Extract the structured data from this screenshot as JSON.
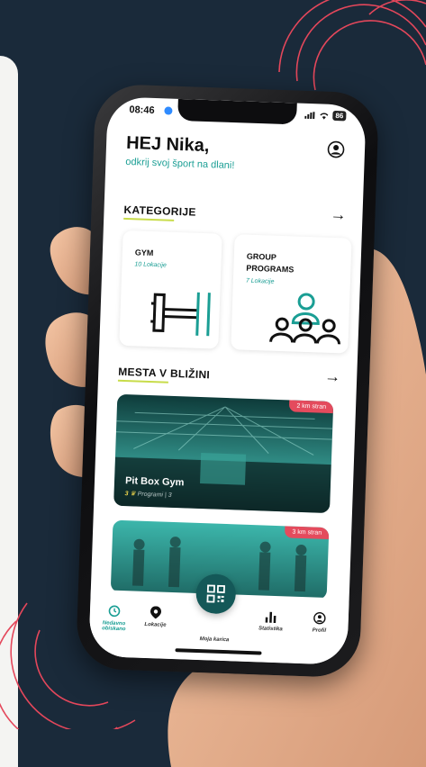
{
  "status_bar": {
    "time": "08:46",
    "battery": "86"
  },
  "header": {
    "greeting": "HEJ Nika,",
    "tagline": "odkrij svoj šport na dlani!"
  },
  "categories_section": {
    "title": "KATEGORIJE",
    "cards": [
      {
        "name": "GYM",
        "count": "10 Lokacije"
      },
      {
        "name": "GROUP\nPROGRAMS",
        "count": "7 Lokacije"
      }
    ]
  },
  "nearby_section": {
    "title": "MESTA V BLIŽINI",
    "places": [
      {
        "name": "Pit Box Gym",
        "distance": "2 km stran",
        "rating": "3",
        "meta": "Programi | 3"
      },
      {
        "name": "",
        "distance": "3 km stran"
      }
    ]
  },
  "bottom_nav": {
    "items": [
      {
        "label": "Nedavno obiskano",
        "icon": "recent-icon",
        "active": true
      },
      {
        "label": "Lokacije",
        "icon": "location-pin-icon"
      },
      {
        "label": "Moja karica",
        "icon": "qr-code-icon"
      },
      {
        "label": "Statistika",
        "icon": "bar-chart-icon"
      },
      {
        "label": "Profil",
        "icon": "user-icon"
      }
    ]
  },
  "colors": {
    "accent": "#1a9e94",
    "dark_teal": "#145858",
    "badge": "#e44b5d",
    "underline": "#c8dc4a",
    "background": "#1a2a3a"
  }
}
